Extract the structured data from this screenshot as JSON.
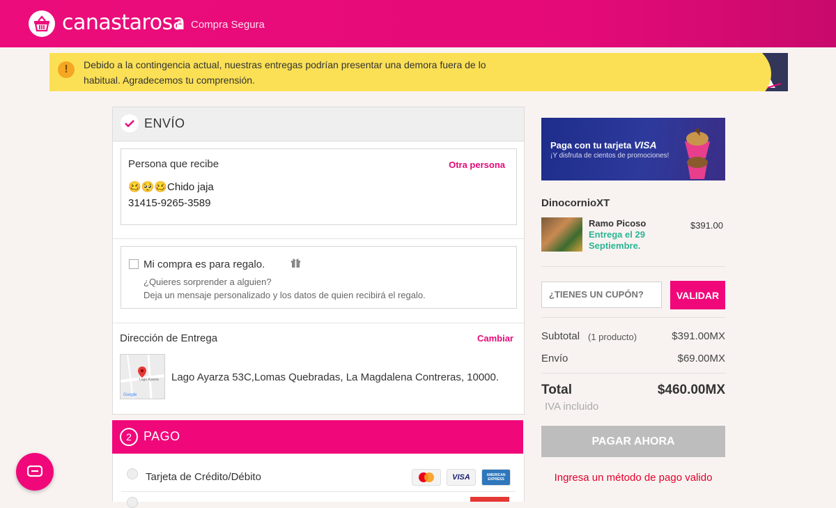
{
  "header": {
    "brand": "canastarosa",
    "secure_label": "Compra Segura",
    "brand_color": "#ec0c7b"
  },
  "banner": {
    "text": "Debido a la contingencia actual, nuestras entregas podrían presentar una demora fuera de lo habitual. Agradecemos tu comprensión.",
    "icon": "warning-icon"
  },
  "envio": {
    "title": "ENVÍO",
    "recipient": {
      "title": "Persona que recibe",
      "change_link": "Otra persona",
      "name": "🥴🥺🥴Chido jaja",
      "phone": "31415-9265-3589"
    },
    "gift": {
      "label": "Mi compra es para regalo.",
      "line1": "¿Quieres sorprender a alguien?",
      "line2": "Deja un mensaje personalizado y los datos de quien recibirá el regalo.",
      "checked": false
    },
    "address": {
      "title": "Dirección de Entrega",
      "change_link": "Cambiar",
      "text": "Lago Ayarza 53C,Lomas Quebradas, La Magdalena Contreras, 10000.",
      "map_label": "Lago Ayarza",
      "map_brand": "Google"
    }
  },
  "pago": {
    "step": "2",
    "title": "PAGO",
    "methods": [
      {
        "label": "Tarjeta de Crédito/Débito",
        "logos": [
          "mastercard-icon",
          "visa-icon",
          "amex-icon"
        ]
      }
    ],
    "logo_text": {
      "visa": "VISA",
      "amex": "AMERICAN EXPRESS"
    }
  },
  "promo": {
    "line1": "Paga con tu tarjeta",
    "brand": "VISA",
    "line2": "¡Y disfruta de cientos de promociones!"
  },
  "order": {
    "store": "DinocornioXT",
    "product": {
      "name": "Ramo Picoso",
      "delivery": "Entrega el 29 Septiembre.",
      "price": "$391.00"
    }
  },
  "coupon": {
    "placeholder": "¿TIENES UN CUPÓN?",
    "button": "VALIDAR"
  },
  "summary": {
    "subtotal_label": "Subtotal",
    "subtotal_count": "(1 producto)",
    "subtotal_value": "$391.00MX",
    "shipping_label": "Envío",
    "shipping_value": "$69.00MX",
    "total_label": "Total",
    "total_value": "$460.00MX",
    "tax_note": "IVA incluido"
  },
  "actions": {
    "pay_button": "PAGAR AHORA",
    "error": "Ingresa un método de pago valido"
  }
}
